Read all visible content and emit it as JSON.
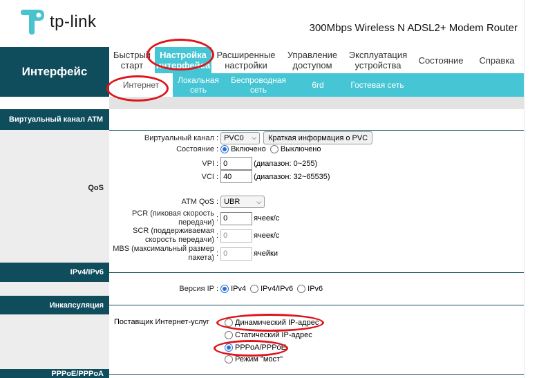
{
  "header": {
    "logo_text": "tp-link",
    "model": "300Mbps Wireless N ADSL2+ Modem Router"
  },
  "side_title": "Интерфейс",
  "top_menu": [
    {
      "label": "Быстрый старт"
    },
    {
      "label": "Настройка интерфейса",
      "active": true
    },
    {
      "label": "Расширенные настройки"
    },
    {
      "label": "Управление доступом"
    },
    {
      "label": "Эксплуатация устройства"
    },
    {
      "label": "Состояние"
    },
    {
      "label": "Справка"
    }
  ],
  "sub_menu": [
    {
      "label": "Интернет",
      "active": true
    },
    {
      "label": "Локальная сеть"
    },
    {
      "label": "Беспроводная сеть"
    },
    {
      "label": "6rd"
    },
    {
      "label": "Гостевая сеть"
    }
  ],
  "sections": {
    "atm": "Виртуальный канал ATM",
    "qos": "QoS",
    "ipv": "IPv4/IPv6",
    "encap": "Инкапсуляция",
    "pppoe": "PPPoE/PPPoA"
  },
  "form": {
    "vc_label": "Виртуальный канал",
    "vc_value": "PVC0",
    "vc_info_button": "Краткая информация о PVC",
    "state_label": "Состояние",
    "state_on": "Включено",
    "state_off": "Выключено",
    "vpi_label": "VPI",
    "vpi_value": "0",
    "vpi_range": "(диапазон: 0~255)",
    "vci_label": "VCI",
    "vci_value": "40",
    "vci_range": "(диапазон: 32~65535)",
    "atmqos_label": "ATM QoS",
    "atmqos_value": "UBR",
    "pcr_label": "PCR (пиковая скорость передачи)",
    "pcr_value": "0",
    "pcr_unit": "ячеек/с",
    "scr_label": "SCR (поддерживаемая скорость передачи)",
    "scr_value": "0",
    "scr_unit": "ячеек/с",
    "mbs_label": "MBS (максимальный размер пакета)",
    "mbs_value": "0",
    "mbs_unit": "ячейки",
    "ipver_label": "Версия IP",
    "ipv4": "IPv4",
    "ipv4v6": "IPv4/IPv6",
    "ipv6": "IPv6",
    "isp_label": "Поставщик Интернет-услуг",
    "isp_dynamic": "Динамический IP-адрес",
    "isp_static": "Статический IP-адрес",
    "isp_pppoe": "PPPoA/PPPoE",
    "isp_bridge": "Режим \"мост\""
  },
  "colors": {
    "accent": "#46c6d4",
    "dark": "#0f4c5c",
    "annotation": "#e0141b"
  }
}
